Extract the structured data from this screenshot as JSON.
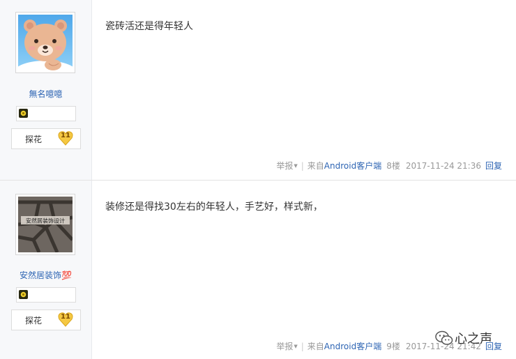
{
  "posts": [
    {
      "username": "無名噫噫",
      "badge_label": "探花",
      "badge_count": "11",
      "content": "瓷砖活还是得年轻人",
      "tail": {
        "report": "举报",
        "from": "来自",
        "client": "Android客户端",
        "floor": "8楼",
        "time": "2017-11-24 21:36",
        "reply": "回复"
      }
    },
    {
      "username": "安然居装饰💯",
      "badge_label": "探花",
      "badge_count": "11",
      "content": "装修还是得找30左右的年轻人，手艺好，样式新，",
      "avatar_text": "安然居装饰设计",
      "tail": {
        "report": "举报",
        "from": "来自",
        "client": "Android客户端",
        "floor": "9楼",
        "time": "2017-11-24 21:42",
        "reply": "回复"
      }
    }
  ],
  "watermark": {
    "text": "心之声",
    "icon": "wechat-icon"
  },
  "colors": {
    "link": "#2d64b3",
    "sidebar_bg": "#f7f8fa",
    "muted": "#999999",
    "badge_gold": "#f5c842"
  }
}
